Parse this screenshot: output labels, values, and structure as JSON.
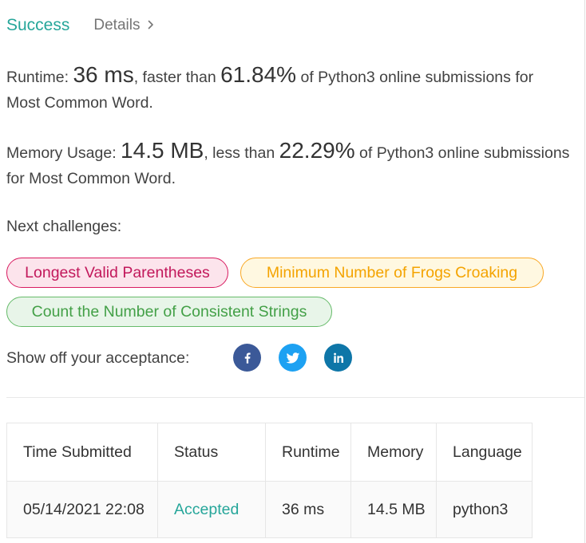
{
  "tabs": {
    "success": "Success",
    "details": "Details"
  },
  "runtime": {
    "label": "Runtime: ",
    "value": "36 ms",
    "mid": ", faster than ",
    "percent": "61.84%",
    "tail1": " of Python3 online submissions for",
    "tail2": "Most Common Word."
  },
  "memory": {
    "label": "Memory Usage: ",
    "value": "14.5 MB",
    "mid": ", less than ",
    "percent": "22.29%",
    "tail1": " of Python3 online submissions",
    "tail2": "for Most Common Word."
  },
  "next": {
    "label": "Next challenges:",
    "challenges": [
      {
        "title": "Longest Valid Parentheses",
        "difficulty_color": "#d81b60"
      },
      {
        "title": "Minimum Number of Frogs Croaking",
        "difficulty_color": "#f9a825"
      },
      {
        "title": "Count the Number of Consistent Strings",
        "difficulty_color": "#43a047"
      }
    ]
  },
  "share": {
    "label": "Show off your acceptance:",
    "icons": [
      "facebook-icon",
      "twitter-icon",
      "linkedin-icon"
    ]
  },
  "table": {
    "headers": [
      "Time Submitted",
      "Status",
      "Runtime",
      "Memory",
      "Language"
    ],
    "rows": [
      {
        "time": "05/14/2021 22:08",
        "status": "Accepted",
        "runtime": "36 ms",
        "memory": "14.5 MB",
        "language": "python3"
      }
    ]
  },
  "colors": {
    "accent": "#26a69a",
    "hard": "#d81b60",
    "medium": "#f9a825",
    "easy": "#43a047"
  }
}
